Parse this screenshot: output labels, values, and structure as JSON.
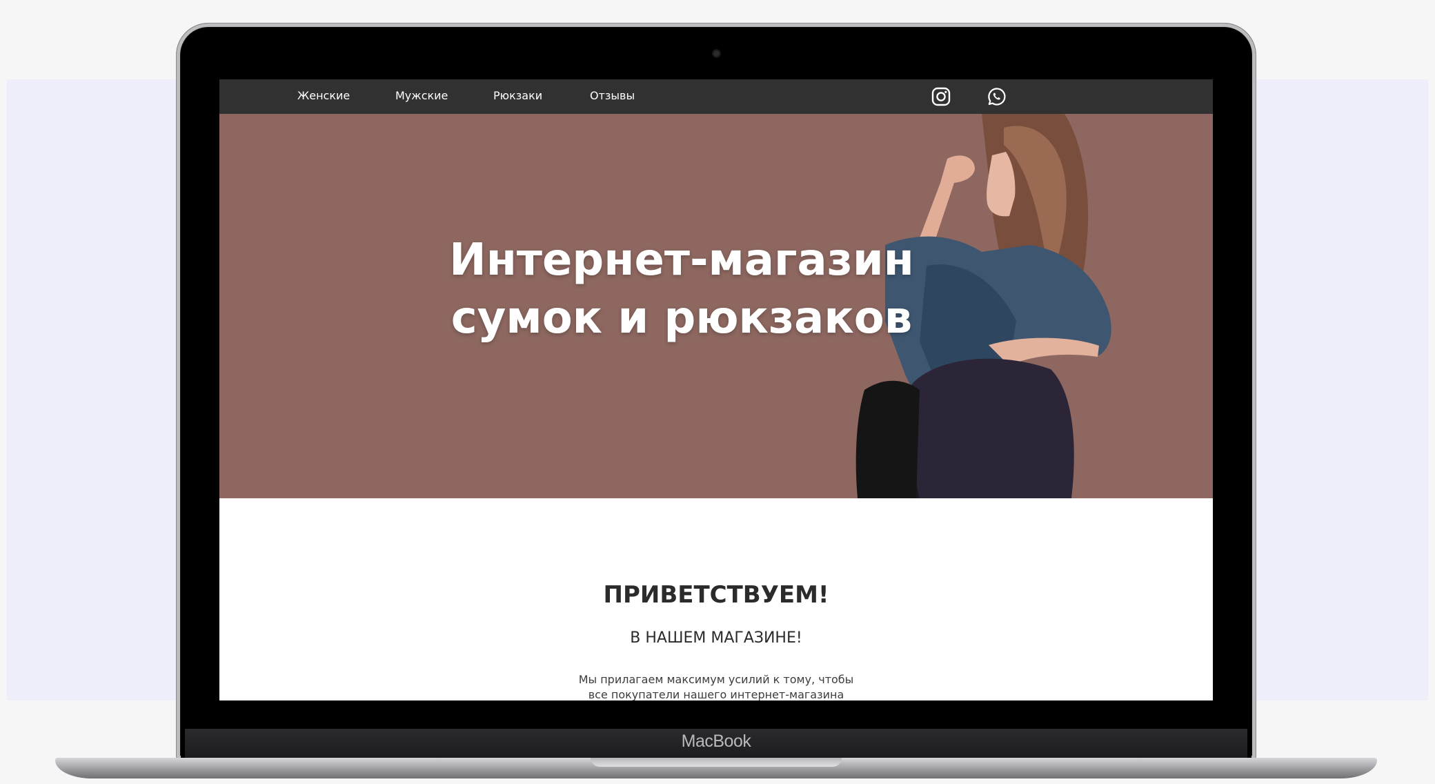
{
  "nav": {
    "items": [
      {
        "label": "Женские"
      },
      {
        "label": "Мужские"
      },
      {
        "label": "Рюкзаки"
      },
      {
        "label": "Отзывы"
      }
    ],
    "icons": [
      "instagram-icon",
      "whatsapp-icon"
    ]
  },
  "hero": {
    "title_line1": "Интернет-магазин",
    "title_line2": "сумок и рюкзаков"
  },
  "welcome": {
    "title": "ПРИВЕТСТВУЕМ!",
    "subtitle": "В НАШЕМ МАГАЗИНЕ!",
    "text_line1": "Мы прилагаем максимум усилий к тому, чтобы",
    "text_line2": "все покупатели нашего интернет-магазина"
  },
  "device": {
    "brand": "MacBook"
  },
  "colors": {
    "navbar": "#313131",
    "hero_bg": "#8d6760",
    "text_dark": "#2b2b2b",
    "backdrop": "#efeffb"
  }
}
